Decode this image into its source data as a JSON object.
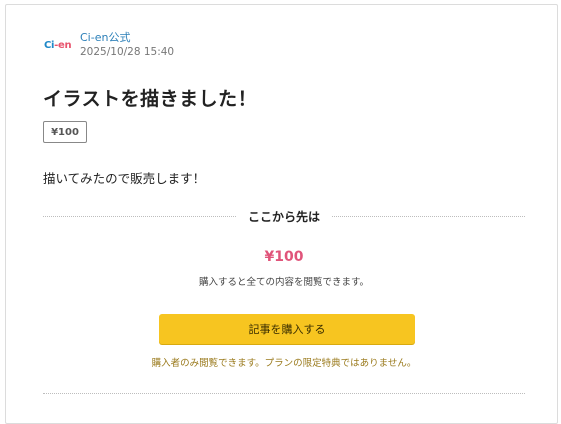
{
  "post": {
    "author": "Ci-en公式",
    "date": "2025/10/28 15:40",
    "logo_text_1": "Ci",
    "logo_text_2": "-en",
    "title": "イラストを描きました！",
    "price_badge": "¥100",
    "body": "描いてみたので販売します！"
  },
  "paywall": {
    "divider_label": "ここから先は",
    "price": "¥100",
    "description": "購入すると全ての内容を閲覧できます。",
    "buy_button": "記事を購入する",
    "note": "購入者のみ閲覧できます。プランの限定特典ではありません。"
  },
  "colors": {
    "accent_price": "#e0547a",
    "button": "#f7c520",
    "author_link": "#2b7fb8",
    "note": "#9a7a1c"
  }
}
